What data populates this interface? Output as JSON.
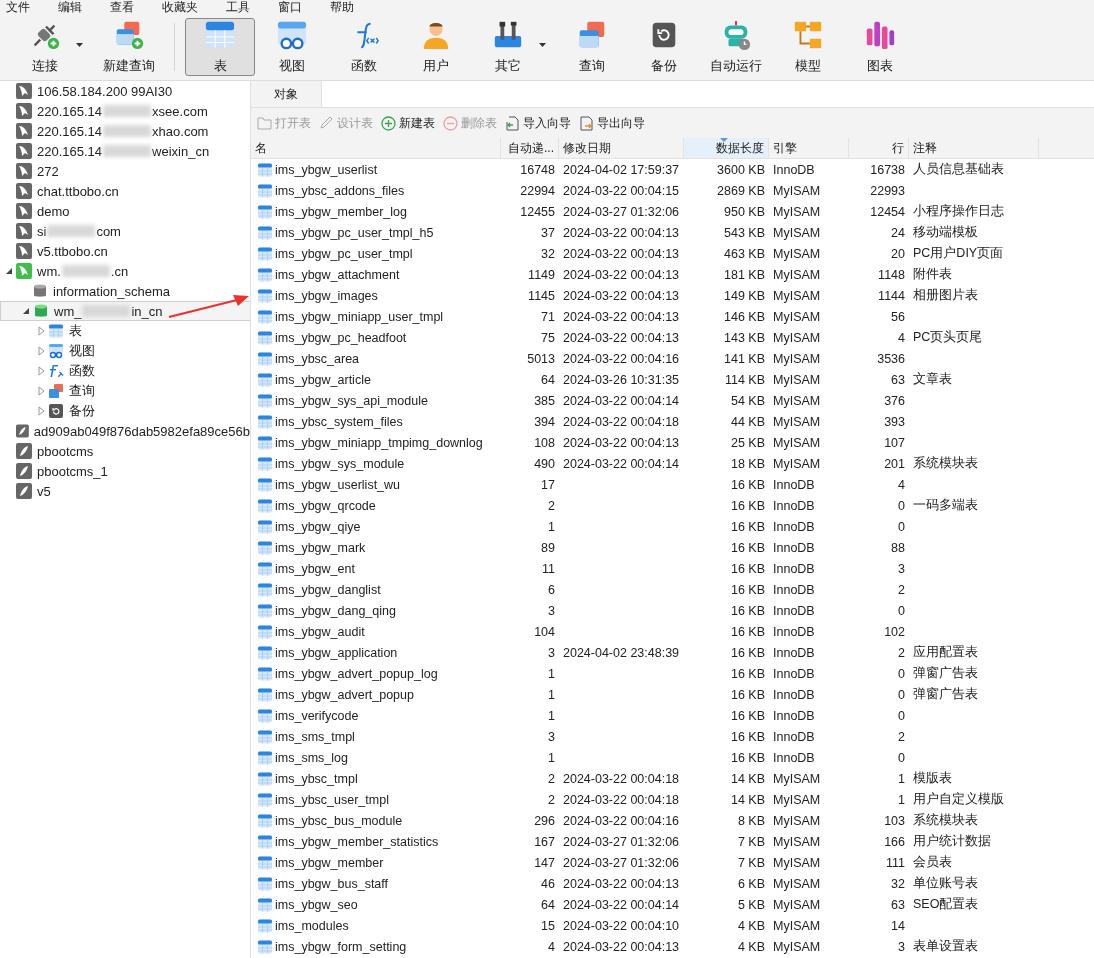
{
  "menu": [
    "文件",
    "编辑",
    "查看",
    "收藏夹",
    "工具",
    "窗口",
    "帮助"
  ],
  "toolbar": [
    {
      "label": "连接",
      "kind": "connect",
      "selected": false,
      "dropdown": true
    },
    {
      "label": "新建查询",
      "kind": "new-query",
      "selected": false,
      "dropdown": false
    },
    {
      "label": "表",
      "kind": "table",
      "selected": true,
      "dropdown": false
    },
    {
      "label": "视图",
      "kind": "view",
      "selected": false,
      "dropdown": false
    },
    {
      "label": "函数",
      "kind": "function",
      "selected": false,
      "dropdown": false
    },
    {
      "label": "用户",
      "kind": "user",
      "selected": false,
      "dropdown": false
    },
    {
      "label": "其它",
      "kind": "tools",
      "selected": false,
      "dropdown": true
    },
    {
      "label": "查询",
      "kind": "query",
      "selected": false,
      "dropdown": false
    },
    {
      "label": "备份",
      "kind": "backup",
      "selected": false,
      "dropdown": false
    },
    {
      "label": "自动运行",
      "kind": "robot",
      "selected": false,
      "dropdown": false
    },
    {
      "label": "模型",
      "kind": "model",
      "selected": false,
      "dropdown": false
    },
    {
      "label": "图表",
      "kind": "chart",
      "selected": false,
      "dropdown": false
    }
  ],
  "sidebar": {
    "items": [
      {
        "label": "106.58.184.200 99AI30",
        "kind": "mysql",
        "selected": false
      },
      {
        "label": "220.165.14",
        "label_end": "xsee.com",
        "kind": "mysql",
        "selected": false
      },
      {
        "label": "220.165.14",
        "label_end": "xhao.com",
        "kind": "mysql",
        "selected": false
      },
      {
        "label": "220.165.14",
        "label_end": "weixin_cn",
        "kind": "mysql",
        "selected": false
      },
      {
        "label": "272",
        "kind": "mysql",
        "selected": false
      },
      {
        "label": "chat.ttbobo.cn",
        "kind": "mysql",
        "selected": false
      },
      {
        "label": "demo",
        "kind": "mysql",
        "selected": false
      },
      {
        "label": "si",
        "label_end": "com",
        "kind": "mysql",
        "selected": false
      },
      {
        "label": "v5.ttbobo.cn",
        "kind": "mysql",
        "selected": false
      },
      {
        "label": "wm.",
        "label_end": ".cn",
        "kind": "mysql-open",
        "selected": false,
        "expanded": true,
        "children": [
          {
            "label": "information_schema",
            "kind": "database",
            "selected": false
          },
          {
            "label": "wm_",
            "label_end": "in_cn",
            "kind": "database-open",
            "selected": true,
            "expanded": true,
            "children": [
              {
                "label": "表",
                "kind": "table",
                "selected": false,
                "expanded": false
              },
              {
                "label": "视图",
                "kind": "view",
                "selected": false,
                "expanded": false
              },
              {
                "label": "函数",
                "kind": "function",
                "selected": false,
                "expanded": false
              },
              {
                "label": "查询",
                "kind": "query",
                "selected": false,
                "expanded": false
              },
              {
                "label": "备份",
                "kind": "backup",
                "selected": false,
                "expanded": false
              }
            ]
          }
        ]
      },
      {
        "label": "ad909ab049f876dab5982efa89ce56b",
        "kind": "sqlite",
        "selected": false
      },
      {
        "label": "pbootcms",
        "kind": "sqlite",
        "selected": false
      },
      {
        "label": "pbootcms_1",
        "kind": "sqlite",
        "selected": false
      },
      {
        "label": "v5",
        "kind": "sqlite",
        "selected": false
      }
    ]
  },
  "tabs": [
    {
      "label": "对象",
      "selected": true
    }
  ],
  "actions": [
    {
      "label": "打开表",
      "kind": "open",
      "disabled": true
    },
    {
      "label": "设计表",
      "kind": "design",
      "disabled": true
    },
    {
      "label": "新建表",
      "kind": "new",
      "disabled": false
    },
    {
      "label": "删除表",
      "kind": "delete",
      "disabled": true
    },
    {
      "label": "导入向导",
      "kind": "import",
      "disabled": false
    },
    {
      "label": "导出向导",
      "kind": "export",
      "disabled": false
    }
  ],
  "table": {
    "columns": [
      {
        "label": "名",
        "sorted": false
      },
      {
        "label": "自动递...",
        "sorted": false
      },
      {
        "label": "修改日期",
        "sorted": false
      },
      {
        "label": "数据长度",
        "sorted": true
      },
      {
        "label": "引擎",
        "sorted": false
      },
      {
        "label": "行",
        "sorted": false
      },
      {
        "label": "注释",
        "sorted": false
      }
    ],
    "rows": [
      [
        "ims_ybgw_userlist",
        "16748",
        "2024-04-02 17:59:37",
        "3600 KB",
        "InnoDB",
        "16738",
        "人员信息基础表"
      ],
      [
        "ims_ybsc_addons_files",
        "22994",
        "2024-03-22 00:04:15",
        "2869 KB",
        "MyISAM",
        "22993",
        ""
      ],
      [
        "ims_ybgw_member_log",
        "12455",
        "2024-03-27 01:32:06",
        "950 KB",
        "MyISAM",
        "12454",
        "小程序操作日志"
      ],
      [
        "ims_ybgw_pc_user_tmpl_h5",
        "37",
        "2024-03-22 00:04:13",
        "543 KB",
        "MyISAM",
        "24",
        "移动端模板"
      ],
      [
        "ims_ybgw_pc_user_tmpl",
        "32",
        "2024-03-22 00:04:13",
        "463 KB",
        "MyISAM",
        "20",
        "PC用户DIY页面"
      ],
      [
        "ims_ybgw_attachment",
        "1149",
        "2024-03-22 00:04:13",
        "181 KB",
        "MyISAM",
        "1148",
        "附件表"
      ],
      [
        "ims_ybgw_images",
        "1145",
        "2024-03-22 00:04:13",
        "149 KB",
        "MyISAM",
        "1144",
        "相册图片表"
      ],
      [
        "ims_ybgw_miniapp_user_tmpl",
        "71",
        "2024-03-22 00:04:13",
        "146 KB",
        "MyISAM",
        "56",
        ""
      ],
      [
        "ims_ybgw_pc_headfoot",
        "75",
        "2024-03-22 00:04:13",
        "143 KB",
        "MyISAM",
        "4",
        "PC页头页尾"
      ],
      [
        "ims_ybsc_area",
        "5013",
        "2024-03-22 00:04:16",
        "141 KB",
        "MyISAM",
        "3536",
        ""
      ],
      [
        "ims_ybgw_article",
        "64",
        "2024-03-26 10:31:35",
        "114 KB",
        "MyISAM",
        "63",
        "文章表"
      ],
      [
        "ims_ybgw_sys_api_module",
        "385",
        "2024-03-22 00:04:14",
        "54 KB",
        "MyISAM",
        "376",
        ""
      ],
      [
        "ims_ybsc_system_files",
        "394",
        "2024-03-22 00:04:18",
        "44 KB",
        "MyISAM",
        "393",
        ""
      ],
      [
        "ims_ybgw_miniapp_tmpimg_downlog",
        "108",
        "2024-03-22 00:04:13",
        "25 KB",
        "MyISAM",
        "107",
        ""
      ],
      [
        "ims_ybgw_sys_module",
        "490",
        "2024-03-22 00:04:14",
        "18 KB",
        "MyISAM",
        "201",
        "系统模块表"
      ],
      [
        "ims_ybgw_userlist_wu",
        "17",
        "",
        "16 KB",
        "InnoDB",
        "4",
        ""
      ],
      [
        "ims_ybgw_qrcode",
        "2",
        "",
        "16 KB",
        "InnoDB",
        "0",
        "一码多端表"
      ],
      [
        "ims_ybgw_qiye",
        "1",
        "",
        "16 KB",
        "InnoDB",
        "0",
        ""
      ],
      [
        "ims_ybgw_mark",
        "89",
        "",
        "16 KB",
        "InnoDB",
        "88",
        ""
      ],
      [
        "ims_ybgw_ent",
        "11",
        "",
        "16 KB",
        "InnoDB",
        "3",
        ""
      ],
      [
        "ims_ybgw_danglist",
        "6",
        "",
        "16 KB",
        "InnoDB",
        "2",
        ""
      ],
      [
        "ims_ybgw_dang_qing",
        "3",
        "",
        "16 KB",
        "InnoDB",
        "0",
        ""
      ],
      [
        "ims_ybgw_audit",
        "104",
        "",
        "16 KB",
        "InnoDB",
        "102",
        ""
      ],
      [
        "ims_ybgw_application",
        "3",
        "2024-04-02 23:48:39",
        "16 KB",
        "InnoDB",
        "2",
        "应用配置表"
      ],
      [
        "ims_ybgw_advert_popup_log",
        "1",
        "",
        "16 KB",
        "InnoDB",
        "0",
        "弹窗广告表"
      ],
      [
        "ims_ybgw_advert_popup",
        "1",
        "",
        "16 KB",
        "InnoDB",
        "0",
        "弹窗广告表"
      ],
      [
        "ims_verifycode",
        "1",
        "",
        "16 KB",
        "InnoDB",
        "0",
        ""
      ],
      [
        "ims_sms_tmpl",
        "3",
        "",
        "16 KB",
        "InnoDB",
        "2",
        ""
      ],
      [
        "ims_sms_log",
        "1",
        "",
        "16 KB",
        "InnoDB",
        "0",
        ""
      ],
      [
        "ims_ybsc_tmpl",
        "2",
        "2024-03-22 00:04:18",
        "14 KB",
        "MyISAM",
        "1",
        "模版表"
      ],
      [
        "ims_ybsc_user_tmpl",
        "2",
        "2024-03-22 00:04:18",
        "14 KB",
        "MyISAM",
        "1",
        "用户自定义模版"
      ],
      [
        "ims_ybsc_bus_module",
        "296",
        "2024-03-22 00:04:16",
        "8 KB",
        "MyISAM",
        "103",
        "系统模块表"
      ],
      [
        "ims_ybgw_member_statistics",
        "167",
        "2024-03-27 01:32:06",
        "7 KB",
        "MyISAM",
        "166",
        "用户统计数据"
      ],
      [
        "ims_ybgw_member",
        "147",
        "2024-03-27 01:32:06",
        "7 KB",
        "MyISAM",
        "111",
        "会员表"
      ],
      [
        "ims_ybgw_bus_staff",
        "46",
        "2024-03-22 00:04:13",
        "6 KB",
        "MyISAM",
        "32",
        "单位账号表"
      ],
      [
        "ims_ybgw_seo",
        "64",
        "2024-03-22 00:04:14",
        "5 KB",
        "MyISAM",
        "63",
        "SEO配置表"
      ],
      [
        "ims_modules",
        "15",
        "2024-03-22 00:04:10",
        "4 KB",
        "MyISAM",
        "14",
        ""
      ],
      [
        "ims_ybgw_form_setting",
        "4",
        "2024-03-22 00:04:13",
        "4 KB",
        "MyISAM",
        "3",
        "表单设置表"
      ]
    ]
  }
}
